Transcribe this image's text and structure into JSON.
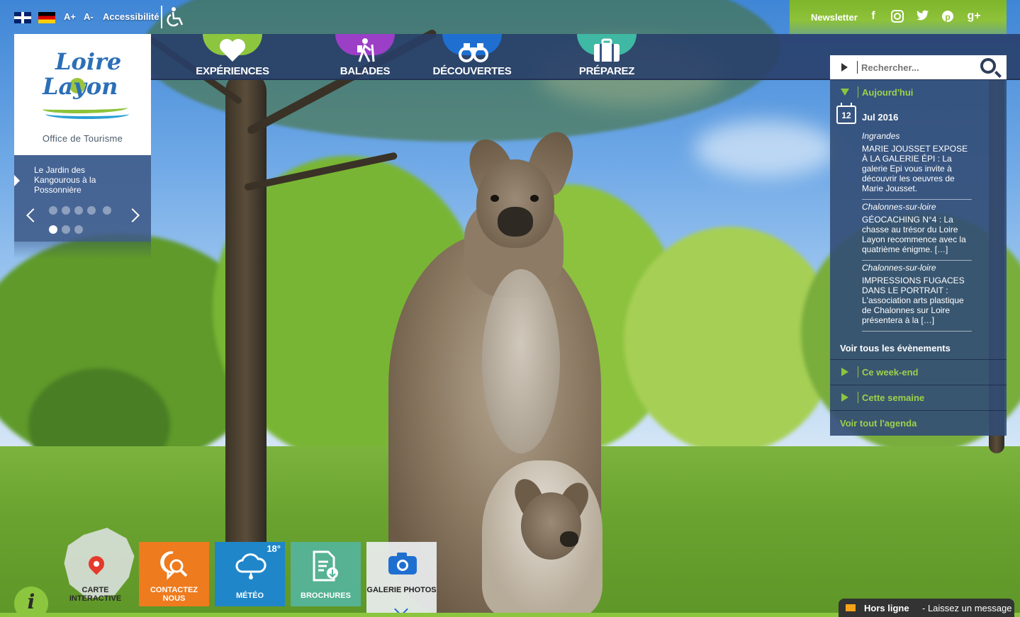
{
  "topbar": {
    "lang_en": "English",
    "lang_de": "Deutsch",
    "font_plus": "A+",
    "font_minus": "A-",
    "accessibility": "Accessibilité"
  },
  "social": {
    "newsletter": "Newsletter",
    "facebook": "f",
    "instagram": "◙",
    "twitter": "🐦",
    "pinterest": "℗",
    "googleplus": "g+"
  },
  "nav": {
    "items": [
      {
        "label": "EXPÉRIENCES",
        "icon": "heart-icon",
        "color": "#8cc63f"
      },
      {
        "label": "BALADES",
        "icon": "hiker-icon",
        "color": "#9b3fc7"
      },
      {
        "label": "DÉCOUVERTES",
        "icon": "binoculars-icon",
        "color": "#1f6fd1"
      },
      {
        "label": "PRÉPAREZ",
        "icon": "suitcase-icon",
        "color": "#3fb8a4"
      }
    ]
  },
  "logo": {
    "line1": "Loire",
    "line2": "Layon",
    "subtitle": "Office de Tourisme"
  },
  "slider": {
    "caption": "Le Jardin des Kangourous à la Possonnière",
    "active_index": 5
  },
  "search": {
    "placeholder": "Rechercher..."
  },
  "agenda": {
    "today": "Aujourd'hui",
    "day": "12",
    "date": "Jul 2016",
    "events": [
      {
        "place": "Ingrandes",
        "text": "MARIE JOUSSET EXPOSE À LA GALERIE ÉPI : La galerie Epi vous invite à découvrir les oeuvres de Marie Jousset."
      },
      {
        "place": "Chalonnes-sur-loire",
        "text": "GÉOCACHING N°4 : La chasse au trésor du Loire Layon recommence avec la quatrième énigme. […]"
      },
      {
        "place": "Chalonnes-sur-loire",
        "text": "IMPRESSIONS FUGACES DANS LE PORTRAIT : L'association arts plastique de Chalonnes sur Loire présentera à la […]"
      }
    ],
    "see_all_events": "Voir tous les évènements",
    "weekend": "Ce week-end",
    "week": "Cette semaine",
    "see_all_agenda": "Voir tout l'agenda"
  },
  "tiles": {
    "map": "CARTE INTERACTIVE",
    "contact": "CONTACTEZ NOUS",
    "meteo": "MÉTÉO",
    "meteo_temp": "18°",
    "brochures": "BROCHURES",
    "gallery": "GALERIE PHOTOS"
  },
  "info": "i",
  "chat": {
    "status": "Hors ligne",
    "message": "- Laissez un message"
  }
}
